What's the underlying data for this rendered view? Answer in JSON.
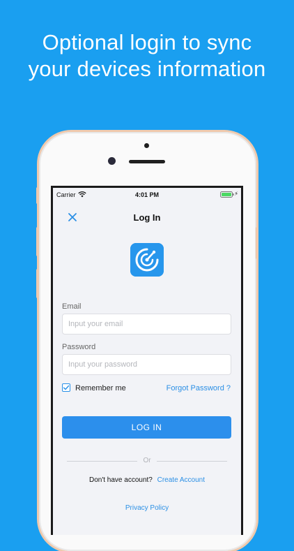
{
  "headline": {
    "line1": "Optional login to sync",
    "line2": "your devices information"
  },
  "colors": {
    "background": "#1a9ff0",
    "accent": "#2c8fec",
    "phone_frame": "#efc9ad"
  },
  "statusbar": {
    "carrier": "Carrier",
    "time": "4:01 PM",
    "battery_icon": "battery-icon",
    "wifi_icon": "wifi-icon"
  },
  "nav": {
    "title": "Log In",
    "close_icon": "close-icon"
  },
  "form": {
    "email_label": "Email",
    "email_placeholder": "Input your email",
    "email_value": "",
    "password_label": "Password",
    "password_placeholder": "Input your password",
    "password_value": "",
    "remember_label": "Remember me",
    "remember_checked": true,
    "forgot_label": "Forgot Password ?",
    "login_label": "LOG IN"
  },
  "footer": {
    "or_label": "Or",
    "no_account_text": "Don't have account?",
    "create_account_label": "Create Account",
    "privacy_label": "Privacy Policy"
  }
}
